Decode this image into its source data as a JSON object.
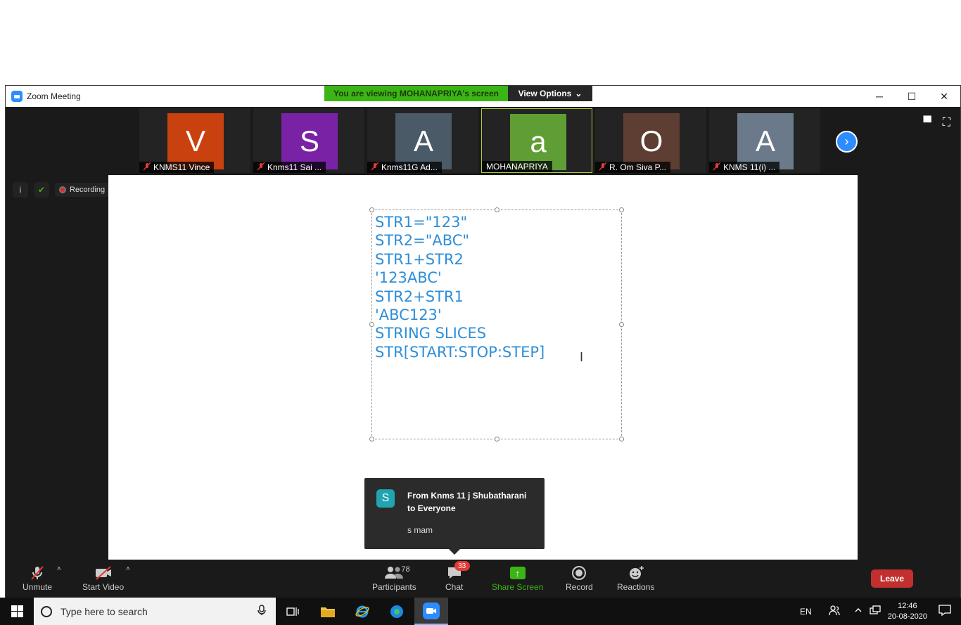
{
  "window": {
    "title": "Zoom Meeting",
    "controls": {
      "minimize": "─",
      "maximize": "☐",
      "close": "✕"
    }
  },
  "banner": {
    "viewing": "You are viewing MOHANAPRIYA's screen",
    "view_options": "View Options",
    "caret": "⌄"
  },
  "participants": [
    {
      "initial": "V",
      "name": "KNMS11 Vince",
      "color": "#c8410e",
      "muted": true
    },
    {
      "initial": "S",
      "name": "Knms11 Sai ...",
      "color": "#7a22a6",
      "muted": true
    },
    {
      "initial": "A",
      "name": "Knms11G Ad...",
      "color": "#4a5a66",
      "muted": true
    },
    {
      "initial": "a",
      "name": "MOHANAPRIYA",
      "color": "#5e9e34",
      "muted": false
    },
    {
      "initial": "O",
      "name": "R. Om Siva P...",
      "color": "#5e3e32",
      "muted": true
    },
    {
      "initial": "A",
      "name": "KNMS 11(i) ...",
      "color": "#6a7a8a",
      "muted": true
    }
  ],
  "strip": {
    "next": "›",
    "gallery_icon": "▀",
    "fullscreen_icon": "⛶"
  },
  "meta": {
    "info": "i",
    "shield": "✔",
    "recording": "Recording"
  },
  "shared_content": {
    "lines": [
      "STR1=\"123\"",
      "STR2=\"ABC\"",
      "STR1+STR2",
      "'123ABC'",
      "STR2+STR1",
      "'ABC123'",
      "STRING SLICES",
      "STR[START:STOP:STEP]"
    ],
    "cursor": "I"
  },
  "chat_toast": {
    "avatar": "S",
    "from": "From Knms 11 j Shubatharani to Everyone",
    "message": "s mam"
  },
  "toolbar": {
    "unmute": "Unmute",
    "start_video": "Start Video",
    "participants": "Participants",
    "participants_count": "78",
    "chat": "Chat",
    "chat_badge": "33",
    "share_screen": "Share Screen",
    "share_icon": "↑",
    "record": "Record",
    "reactions": "Reactions",
    "leave": "Leave",
    "caret": "˄"
  },
  "taskbar": {
    "search_placeholder": "Type here to search",
    "language": "EN",
    "time": "12:46",
    "date": "20-08-2020"
  }
}
